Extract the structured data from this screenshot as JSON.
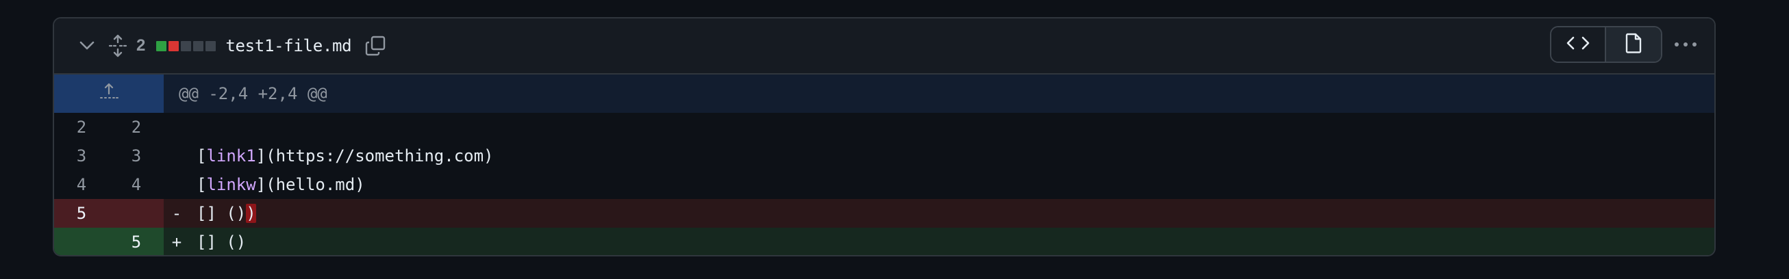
{
  "header": {
    "count": "2",
    "filename": "test1-file.md",
    "diffstat_colors": [
      "#2ea043",
      "#da3633",
      "#3d444d",
      "#3d444d",
      "#3d444d"
    ]
  },
  "hunk": {
    "text": "@@ -2,4 +2,4 @@"
  },
  "lines": [
    {
      "old": "2",
      "new": "2",
      "marker": "",
      "pre": "",
      "kw": "",
      "post": "",
      "hl": ""
    },
    {
      "old": "3",
      "new": "3",
      "marker": "",
      "pre": "[",
      "kw": "link1",
      "post": "](https://something.com)",
      "hl": ""
    },
    {
      "old": "4",
      "new": "4",
      "marker": "",
      "pre": "[",
      "kw": "linkw",
      "post": "](hello.md)",
      "hl": ""
    },
    {
      "old": "5",
      "new": "",
      "marker": "-",
      "pre": "[] ()",
      "kw": "",
      "post": "",
      "hl": ")"
    },
    {
      "old": "",
      "new": "5",
      "marker": "+",
      "pre": "[] ()",
      "kw": "",
      "post": "",
      "hl": ""
    }
  ],
  "icons": {
    "collapse": "chevron-down-icon",
    "expand": "fold-icon",
    "copy": "copy-icon",
    "code": "code-icon",
    "file": "file-icon",
    "more": "kebab-horizontal-icon",
    "expand_up": "fold-up-icon"
  }
}
